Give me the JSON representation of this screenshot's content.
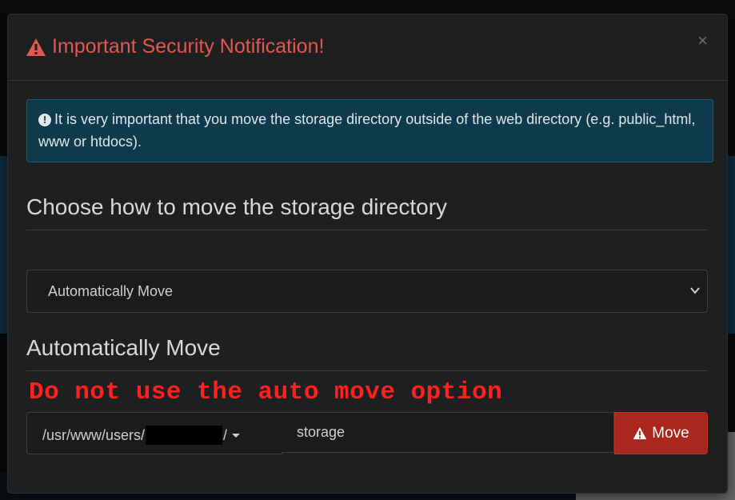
{
  "modal": {
    "title": "Important Security Notification!",
    "close_label": "×"
  },
  "alert": {
    "text": "It is very important that you move the storage directory outside of the web directory (e.g. public_html, www or htdocs)."
  },
  "choose_section": {
    "title": "Choose how to move the storage directory"
  },
  "method_select": {
    "selected": "Automatically Move"
  },
  "auto_section": {
    "title": "Automatically Move",
    "annotation": "Do not use the auto move option"
  },
  "move_form": {
    "path_prefix": "/usr/www/users/",
    "path_suffix": "/",
    "folder_value": "storage",
    "move_label": "Move"
  },
  "colors": {
    "title_red": "#e0584f",
    "alert_bg": "#0f3a4c",
    "move_button": "#a9271d",
    "annotation_red": "#ff2020"
  }
}
